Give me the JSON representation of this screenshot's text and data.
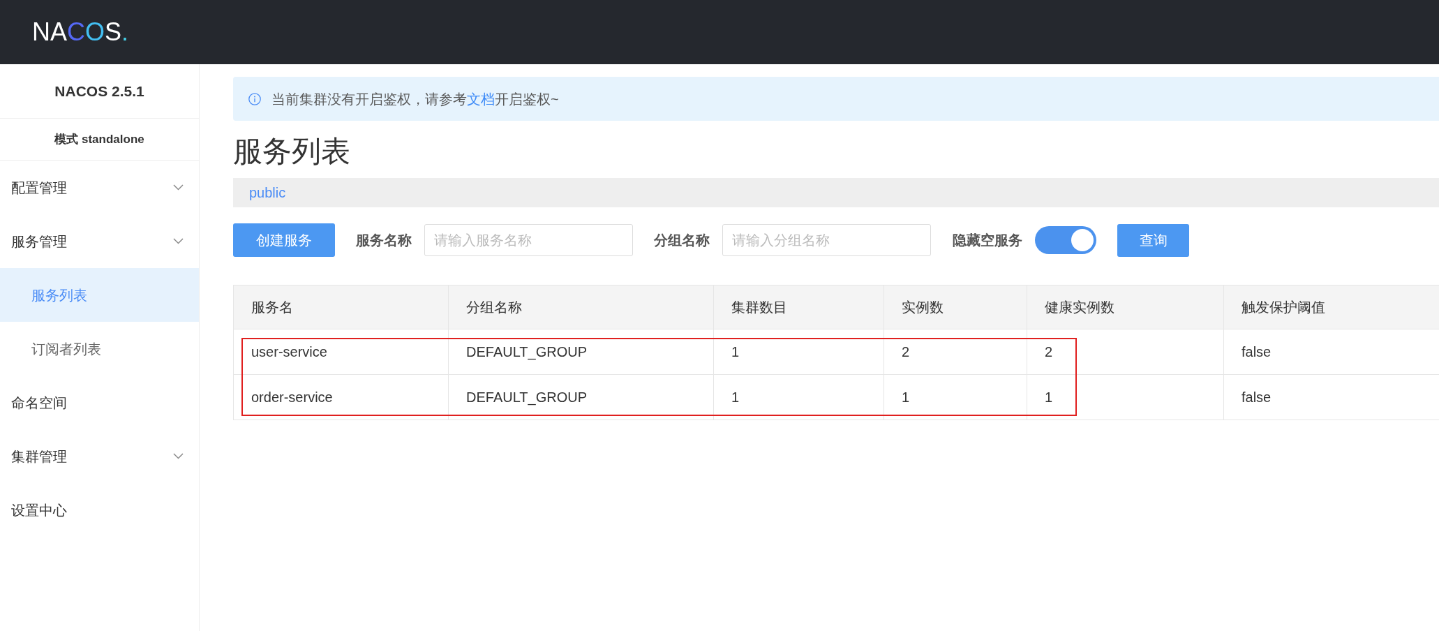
{
  "header": {
    "logo": "NACOS."
  },
  "sidebar": {
    "version": "NACOS 2.5.1",
    "mode": "模式 standalone",
    "items": [
      {
        "label": "配置管理",
        "kind": "group",
        "selected": false
      },
      {
        "label": "服务管理",
        "kind": "group",
        "selected": false,
        "children": [
          {
            "label": "服务列表",
            "selected": true
          },
          {
            "label": "订阅者列表",
            "selected": false
          }
        ]
      },
      {
        "label": "命名空间",
        "kind": "link",
        "selected": false
      },
      {
        "label": "集群管理",
        "kind": "group",
        "selected": false
      },
      {
        "label": "设置中心",
        "kind": "link",
        "selected": false
      }
    ]
  },
  "notice": {
    "text_before": "当前集群没有开启鉴权，请参考",
    "link": "文档",
    "text_after": "开启鉴权~"
  },
  "title": "服务列表",
  "namespaces": [
    {
      "label": "public",
      "selected": true
    }
  ],
  "toolbar": {
    "create_button": "创建服务",
    "fields": [
      {
        "label": "服务名称",
        "placeholder": "请输入服务名称"
      },
      {
        "label": "分组名称",
        "placeholder": "请输入分组名称"
      }
    ],
    "toggle": {
      "label": "隐藏空服务",
      "on": true
    },
    "query_button": "查询"
  },
  "table": {
    "columns": [
      "服务名",
      "分组名称",
      "集群数目",
      "实例数",
      "健康实例数",
      "触发保护阈值"
    ],
    "rows": [
      [
        "user-service",
        "DEFAULT_GROUP",
        "1",
        "2",
        "2",
        "false"
      ],
      [
        "order-service",
        "DEFAULT_GROUP",
        "1",
        "1",
        "1",
        "false"
      ]
    ],
    "highlighted": true
  }
}
